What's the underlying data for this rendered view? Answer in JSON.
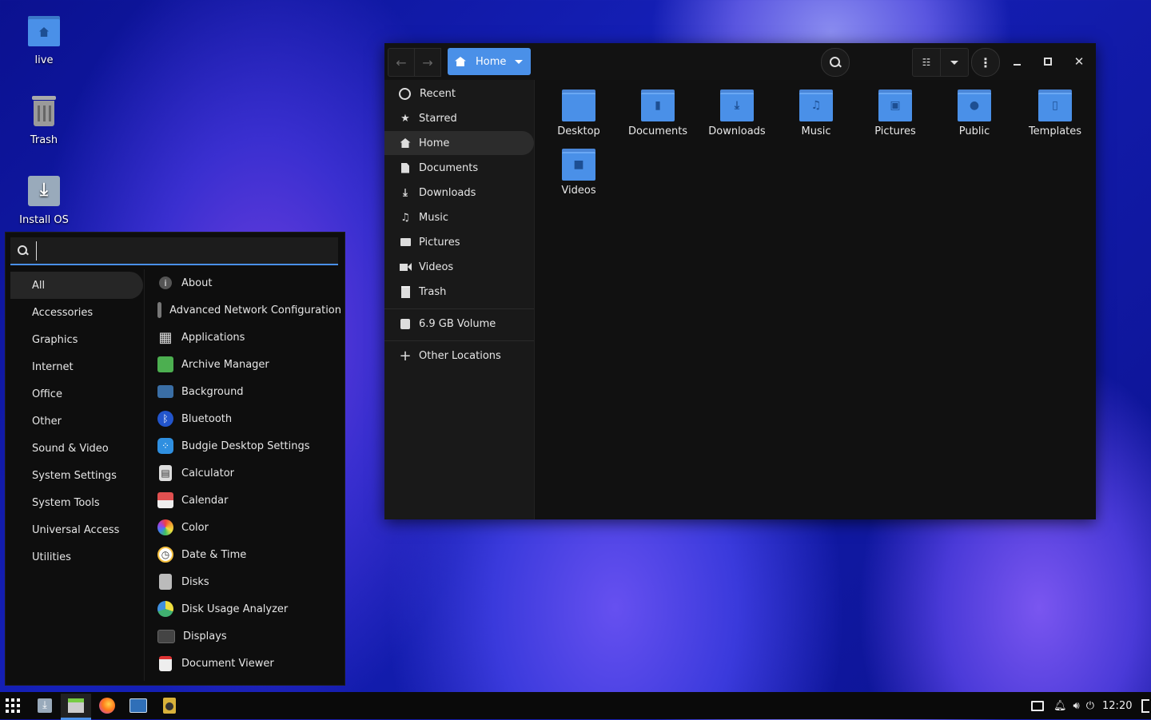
{
  "desktop": {
    "icons": [
      {
        "label": "live",
        "icon": "home-folder-icon"
      },
      {
        "label": "Trash",
        "icon": "trash-icon"
      },
      {
        "label": "Install OS",
        "icon": "install-icon"
      }
    ]
  },
  "file_manager": {
    "location": "Home",
    "sidebar": [
      {
        "label": "Recent",
        "icon": "clock-icon"
      },
      {
        "label": "Starred",
        "icon": "star-icon"
      },
      {
        "label": "Home",
        "icon": "home-icon",
        "active": true
      },
      {
        "label": "Documents",
        "icon": "document-icon"
      },
      {
        "label": "Downloads",
        "icon": "download-icon"
      },
      {
        "label": "Music",
        "icon": "music-icon"
      },
      {
        "label": "Pictures",
        "icon": "picture-icon"
      },
      {
        "label": "Videos",
        "icon": "video-icon"
      },
      {
        "label": "Trash",
        "icon": "trash-icon"
      },
      {
        "label": "6.9 GB Volume",
        "icon": "drive-icon"
      },
      {
        "label": "Other Locations",
        "icon": "plus-icon"
      }
    ],
    "folders": [
      {
        "label": "Desktop",
        "icon": "desktop-folder-icon"
      },
      {
        "label": "Documents",
        "icon": "documents-folder-icon"
      },
      {
        "label": "Downloads",
        "icon": "downloads-folder-icon"
      },
      {
        "label": "Music",
        "icon": "music-folder-icon"
      },
      {
        "label": "Pictures",
        "icon": "pictures-folder-icon"
      },
      {
        "label": "Public",
        "icon": "public-folder-icon"
      },
      {
        "label": "Templates",
        "icon": "templates-folder-icon"
      },
      {
        "label": "Videos",
        "icon": "videos-folder-icon"
      }
    ]
  },
  "menu": {
    "search_value": "",
    "categories": [
      "All",
      "Accessories",
      "Graphics",
      "Internet",
      "Office",
      "Other",
      "Sound & Video",
      "System Settings",
      "System Tools",
      "Universal Access",
      "Utilities"
    ],
    "apps": [
      {
        "label": "About",
        "icon": "info-icon",
        "color": "#555555"
      },
      {
        "label": "Advanced Network Configuration",
        "icon": "network-icon",
        "color": "#777777"
      },
      {
        "label": "Applications",
        "icon": "grid-icon",
        "color": "#cccccc"
      },
      {
        "label": "Archive Manager",
        "icon": "archive-icon",
        "color": "#4caf50"
      },
      {
        "label": "Background",
        "icon": "background-icon",
        "color": "#3a6ea5"
      },
      {
        "label": "Bluetooth",
        "icon": "bluetooth-icon",
        "color": "#2255cc"
      },
      {
        "label": "Budgie Desktop Settings",
        "icon": "budgie-icon",
        "color": "#2f8fe0"
      },
      {
        "label": "Calculator",
        "icon": "calculator-icon",
        "color": "#dddddd"
      },
      {
        "label": "Calendar",
        "icon": "calendar-icon",
        "color": "#e05050"
      },
      {
        "label": "Color",
        "icon": "color-icon",
        "color": "#f0a030"
      },
      {
        "label": "Date & Time",
        "icon": "clock-icon",
        "color": "#f5c040"
      },
      {
        "label": "Disks",
        "icon": "disks-icon",
        "color": "#bbbbbb"
      },
      {
        "label": "Disk Usage Analyzer",
        "icon": "pie-icon",
        "color": "#40b070"
      },
      {
        "label": "Displays",
        "icon": "display-icon",
        "color": "#444444"
      },
      {
        "label": "Document Viewer",
        "icon": "viewer-icon",
        "color": "#eeeeee"
      }
    ]
  },
  "taskbar": {
    "clock": "12:20"
  },
  "colors": {
    "accent": "#4a90e8"
  }
}
